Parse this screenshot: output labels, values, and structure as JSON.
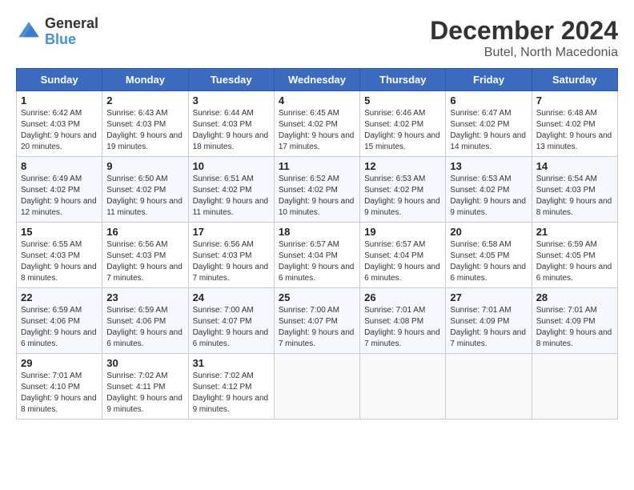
{
  "header": {
    "logo_line1": "General",
    "logo_line2": "Blue",
    "title": "December 2024",
    "subtitle": "Butel, North Macedonia"
  },
  "weekdays": [
    "Sunday",
    "Monday",
    "Tuesday",
    "Wednesday",
    "Thursday",
    "Friday",
    "Saturday"
  ],
  "weeks": [
    [
      {
        "day": "1",
        "sunrise": "6:42 AM",
        "sunset": "4:03 PM",
        "daylight": "9 hours and 20 minutes."
      },
      {
        "day": "2",
        "sunrise": "6:43 AM",
        "sunset": "4:03 PM",
        "daylight": "9 hours and 19 minutes."
      },
      {
        "day": "3",
        "sunrise": "6:44 AM",
        "sunset": "4:03 PM",
        "daylight": "9 hours and 18 minutes."
      },
      {
        "day": "4",
        "sunrise": "6:45 AM",
        "sunset": "4:02 PM",
        "daylight": "9 hours and 17 minutes."
      },
      {
        "day": "5",
        "sunrise": "6:46 AM",
        "sunset": "4:02 PM",
        "daylight": "9 hours and 15 minutes."
      },
      {
        "day": "6",
        "sunrise": "6:47 AM",
        "sunset": "4:02 PM",
        "daylight": "9 hours and 14 minutes."
      },
      {
        "day": "7",
        "sunrise": "6:48 AM",
        "sunset": "4:02 PM",
        "daylight": "9 hours and 13 minutes."
      }
    ],
    [
      {
        "day": "8",
        "sunrise": "6:49 AM",
        "sunset": "4:02 PM",
        "daylight": "9 hours and 12 minutes."
      },
      {
        "day": "9",
        "sunrise": "6:50 AM",
        "sunset": "4:02 PM",
        "daylight": "9 hours and 11 minutes."
      },
      {
        "day": "10",
        "sunrise": "6:51 AM",
        "sunset": "4:02 PM",
        "daylight": "9 hours and 11 minutes."
      },
      {
        "day": "11",
        "sunrise": "6:52 AM",
        "sunset": "4:02 PM",
        "daylight": "9 hours and 10 minutes."
      },
      {
        "day": "12",
        "sunrise": "6:53 AM",
        "sunset": "4:02 PM",
        "daylight": "9 hours and 9 minutes."
      },
      {
        "day": "13",
        "sunrise": "6:53 AM",
        "sunset": "4:02 PM",
        "daylight": "9 hours and 9 minutes."
      },
      {
        "day": "14",
        "sunrise": "6:54 AM",
        "sunset": "4:03 PM",
        "daylight": "9 hours and 8 minutes."
      }
    ],
    [
      {
        "day": "15",
        "sunrise": "6:55 AM",
        "sunset": "4:03 PM",
        "daylight": "9 hours and 8 minutes."
      },
      {
        "day": "16",
        "sunrise": "6:56 AM",
        "sunset": "4:03 PM",
        "daylight": "9 hours and 7 minutes."
      },
      {
        "day": "17",
        "sunrise": "6:56 AM",
        "sunset": "4:03 PM",
        "daylight": "9 hours and 7 minutes."
      },
      {
        "day": "18",
        "sunrise": "6:57 AM",
        "sunset": "4:04 PM",
        "daylight": "9 hours and 6 minutes."
      },
      {
        "day": "19",
        "sunrise": "6:57 AM",
        "sunset": "4:04 PM",
        "daylight": "9 hours and 6 minutes."
      },
      {
        "day": "20",
        "sunrise": "6:58 AM",
        "sunset": "4:05 PM",
        "daylight": "9 hours and 6 minutes."
      },
      {
        "day": "21",
        "sunrise": "6:59 AM",
        "sunset": "4:05 PM",
        "daylight": "9 hours and 6 minutes."
      }
    ],
    [
      {
        "day": "22",
        "sunrise": "6:59 AM",
        "sunset": "4:06 PM",
        "daylight": "9 hours and 6 minutes."
      },
      {
        "day": "23",
        "sunrise": "6:59 AM",
        "sunset": "4:06 PM",
        "daylight": "9 hours and 6 minutes."
      },
      {
        "day": "24",
        "sunrise": "7:00 AM",
        "sunset": "4:07 PM",
        "daylight": "9 hours and 6 minutes."
      },
      {
        "day": "25",
        "sunrise": "7:00 AM",
        "sunset": "4:07 PM",
        "daylight": "9 hours and 7 minutes."
      },
      {
        "day": "26",
        "sunrise": "7:01 AM",
        "sunset": "4:08 PM",
        "daylight": "9 hours and 7 minutes."
      },
      {
        "day": "27",
        "sunrise": "7:01 AM",
        "sunset": "4:09 PM",
        "daylight": "9 hours and 7 minutes."
      },
      {
        "day": "28",
        "sunrise": "7:01 AM",
        "sunset": "4:09 PM",
        "daylight": "9 hours and 8 minutes."
      }
    ],
    [
      {
        "day": "29",
        "sunrise": "7:01 AM",
        "sunset": "4:10 PM",
        "daylight": "9 hours and 8 minutes."
      },
      {
        "day": "30",
        "sunrise": "7:02 AM",
        "sunset": "4:11 PM",
        "daylight": "9 hours and 9 minutes."
      },
      {
        "day": "31",
        "sunrise": "7:02 AM",
        "sunset": "4:12 PM",
        "daylight": "9 hours and 9 minutes."
      },
      null,
      null,
      null,
      null
    ]
  ]
}
